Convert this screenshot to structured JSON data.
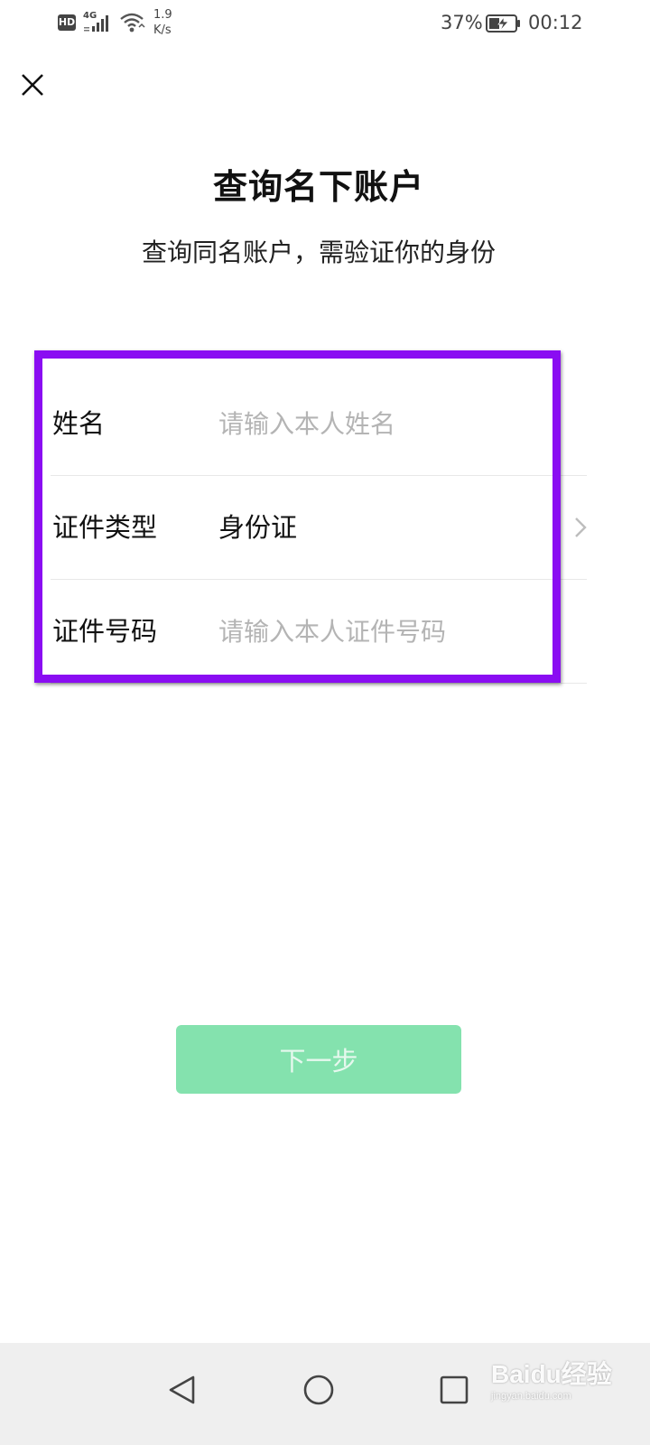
{
  "status_bar": {
    "hd_label": "HD",
    "network_label": "4G",
    "speed_value": "1.9",
    "speed_unit": "K/s",
    "battery_percent": "37%",
    "time": "00:12",
    "icons": [
      "hd-icon",
      "signal-icon",
      "wifi-icon",
      "battery-charging-icon"
    ]
  },
  "header": {
    "close_icon": "close-icon",
    "title": "查询名下账户",
    "subtitle": "查询同名账户，需验证你的身份"
  },
  "form": {
    "rows": [
      {
        "label": "姓名",
        "placeholder": "请输入本人姓名",
        "value": ""
      },
      {
        "label": "证件类型",
        "value": "身份证",
        "icon": "chevron-right-icon"
      },
      {
        "label": "证件号码",
        "placeholder": "请输入本人证件号码",
        "value": ""
      }
    ],
    "highlight_color": "#8a0df2"
  },
  "actions": {
    "next_label": "下一步",
    "next_color": "#84e2ae"
  },
  "nav_bar": {
    "buttons": [
      "back-icon",
      "home-icon",
      "recent-apps-icon"
    ]
  },
  "watermark": {
    "text": "Baidu经验",
    "sub": "jingyan.baidu.com"
  }
}
